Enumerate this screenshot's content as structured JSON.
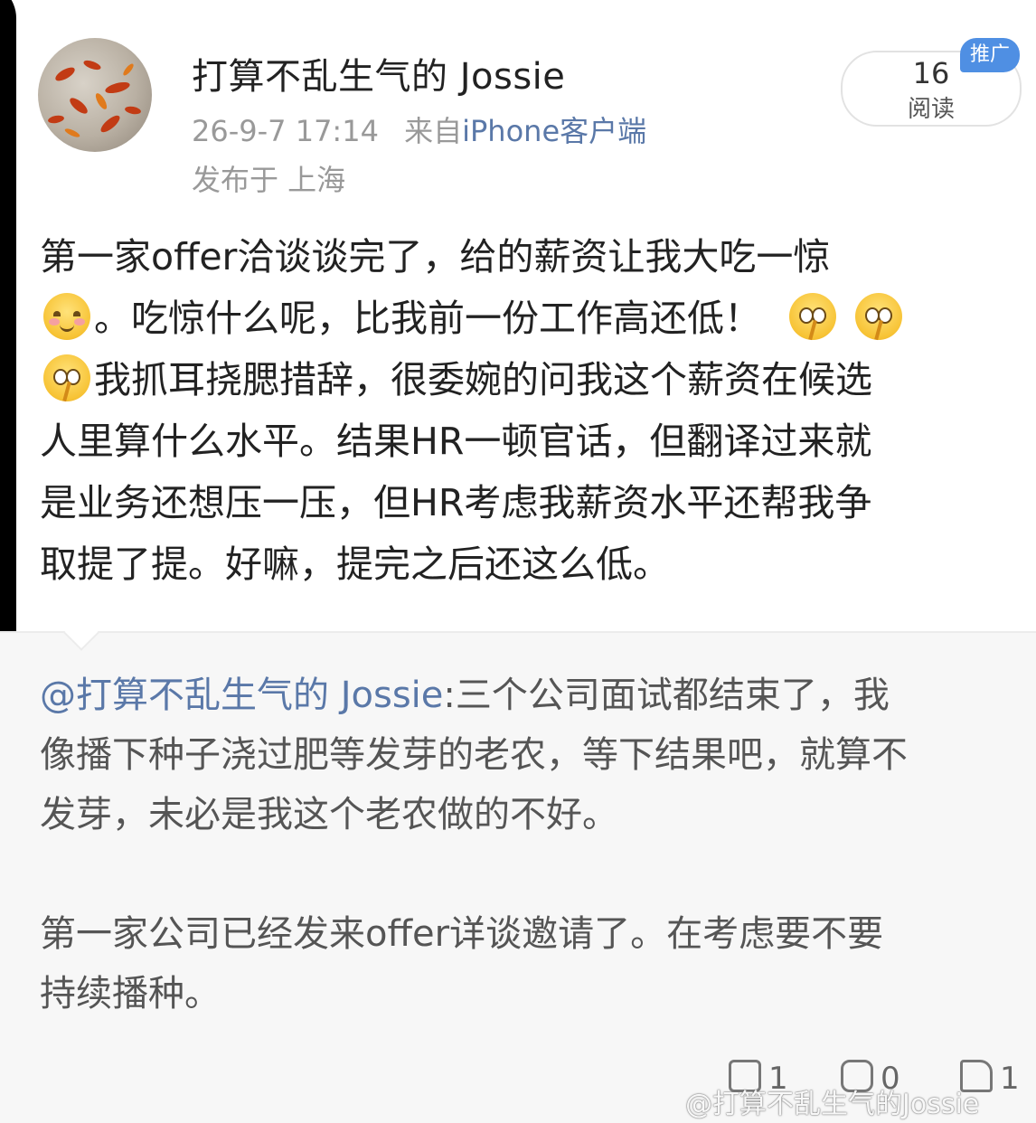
{
  "post": {
    "username": "打算不乱生气的 Jossie",
    "time": "26-9-7 17:14",
    "source_prefix": "来自",
    "source": "iPhone客户端",
    "location": "发布于 上海",
    "reads_count": "16",
    "reads_label": "阅读",
    "promo_badge": "推广",
    "body_line1": "第一家offer洽谈谈完了，给的薪资让我大吃一惊",
    "body_line2": "。吃惊什么呢，比我前一份工作高还低！",
    "body_line3": "我抓耳挠腮措辞，很委婉的问我这个薪资在候选",
    "body_line4": "人里算什么水平。结果HR一顿官话，但翻译过来就",
    "body_line5": "是业务还想压一压，但HR考虑我薪资水平还帮我争",
    "body_line6": "取提了提。好嘛，提完之后还这么低。"
  },
  "quote": {
    "mention": "@打算不乱生气的 Jossie",
    "text_line1": ":三个公司面试都结束了，我",
    "text_line2": "像播下种子浇过肥等发芽的老农，等下结果吧，就算不",
    "text_line3": "发芽，未必是我这个老农做的不好。",
    "text2_line1": "第一家公司已经发来offer详谈邀请了。在考虑要不要",
    "text2_line2": "持续播种。"
  },
  "actions": {
    "repost_count": "1",
    "comment_count": "0",
    "like_count": "1"
  },
  "watermark": "@打算不乱生气的Jossie"
}
